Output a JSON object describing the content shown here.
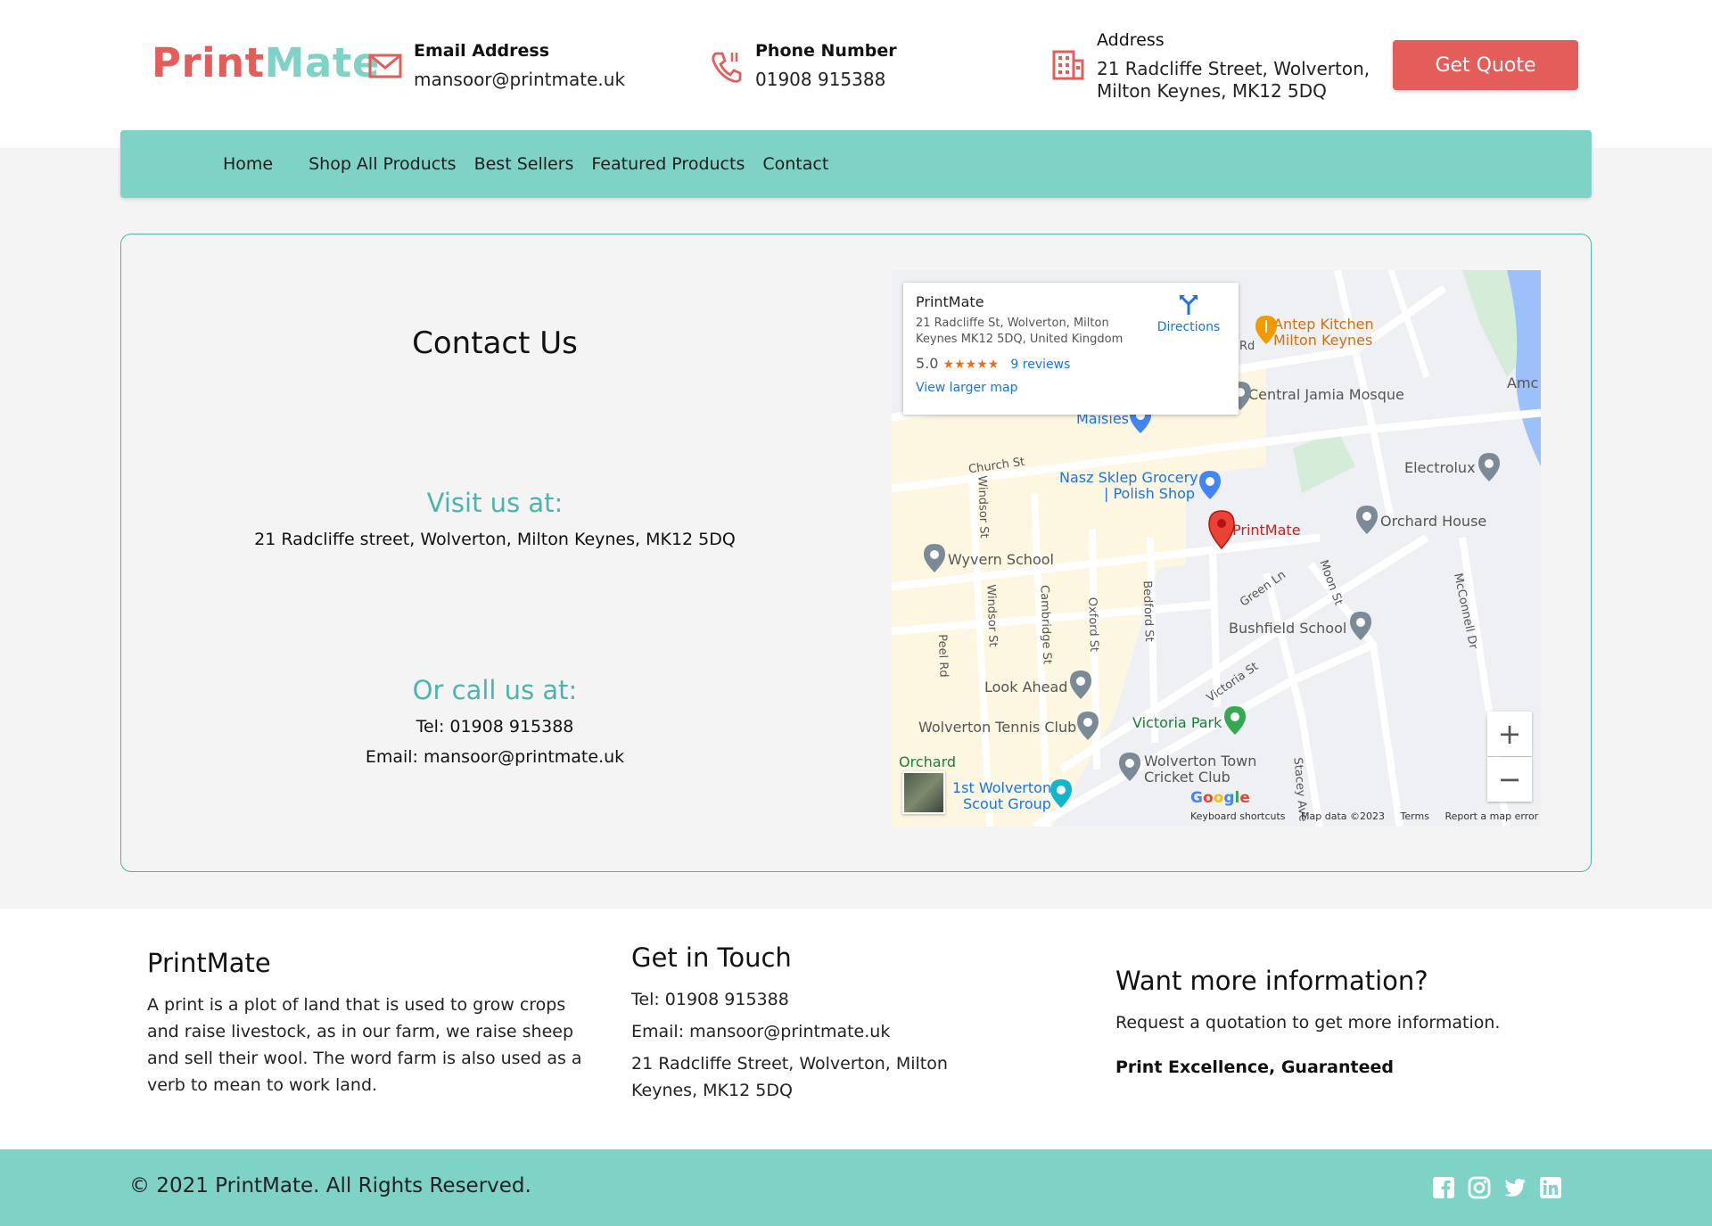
{
  "brand": {
    "part1": "Print",
    "part2": "Mate",
    "color1": "#e35d5b",
    "color2": "#7ed3c6"
  },
  "header": {
    "email_label": "Email Address",
    "email_value": "mansoor@printmate.uk",
    "phone_label": "Phone Number",
    "phone_value": "01908 915388",
    "address_label": "Address",
    "address_line1": "21 Radcliffe Street, Wolverton,",
    "address_line2": "Milton Keynes, MK12 5DQ",
    "quote_button": "Get Quote",
    "icons": {
      "email": "mail-icon",
      "phone": "phone-icon",
      "address": "building-icon"
    }
  },
  "nav": [
    "Home",
    "Shop All Products",
    "Best Sellers",
    "Featured Products",
    "Contact"
  ],
  "contact": {
    "title": "Contact Us",
    "visit_heading": "Visit us at:",
    "visit_address": "21 Radcliffe street, Wolverton, Milton Keynes, MK12 5DQ",
    "call_heading": "Or call us at:",
    "tel": "Tel: 01908 915388",
    "email": "Email: mansoor@printmate.uk"
  },
  "map": {
    "card_name": "PrintMate",
    "card_address": "21 Radcliffe St, Wolverton, Milton Keynes MK12 5DQ, United Kingdom",
    "rating": "5.0",
    "stars": "★★★★★",
    "reviews": "9 reviews",
    "larger_map": "View larger map",
    "directions": "Directions",
    "places": {
      "antep1": "Antep Kitchen",
      "antep2": "Milton Keynes",
      "mosque": "Central Jamia Mosque",
      "maisies": "Maisies",
      "nasz1": "Nasz Sklep Grocery",
      "nasz2": "| Polish Shop",
      "electrolux": "Electrolux",
      "orchard": "Orchard House",
      "printmate": "PrintMate",
      "wyvern": "Wyvern School",
      "bushfield": "Bushfield School",
      "lookahead": "Look Ahead",
      "victoriapark": "Victoria Park",
      "tennis": "Wolverton Tennis Club",
      "cricket1": "Wolverton Town",
      "cricket2": "Cricket Club",
      "orchard2": "Orchard",
      "scout1": "1st Wolverton",
      "scout2": "Scout Group",
      "amc": "Amc"
    },
    "streets": {
      "church": "Church St",
      "windsor1": "Windsor St",
      "windsor2": "Windsor St",
      "cambridge": "Cambridge St",
      "oxford": "Oxford St",
      "bedford": "Bedford St",
      "peel": "Peel Rd",
      "green": "Green Ln",
      "moon": "Moon St",
      "victoria": "Victoria St",
      "mcconnell": "McConnell Dr",
      "stacey": "Stacey Ave",
      "rd": "Rd"
    },
    "google": "Google",
    "footer": [
      "Keyboard shortcuts",
      "Map data ©2023",
      "Terms",
      "Report a map error"
    ],
    "zoom_in": "+",
    "zoom_out": "−"
  },
  "footer": {
    "col1_title": "PrintMate",
    "col1_text": "A print is a plot of land that is used to grow crops and raise livestock, as in our farm, we raise sheep and sell their wool. The word farm is also used as a verb to mean to work land.",
    "col2_title": "Get in Touch",
    "col2_tel": "Tel: 01908 915388",
    "col2_email": "Email: mansoor@printmate.uk",
    "col2_address": "21 Radcliffe Street, Wolverton, Milton Keynes, MK12 5DQ",
    "col3_title": "Want more information?",
    "col3_text": "Request a quotation to get more information.",
    "col3_bold": "Print Excellence, Guaranteed",
    "copyright": "© 2021 PrintMate. All Rights Reserved.",
    "social": [
      "facebook-icon",
      "instagram-icon",
      "twitter-icon",
      "linkedin-icon"
    ]
  }
}
